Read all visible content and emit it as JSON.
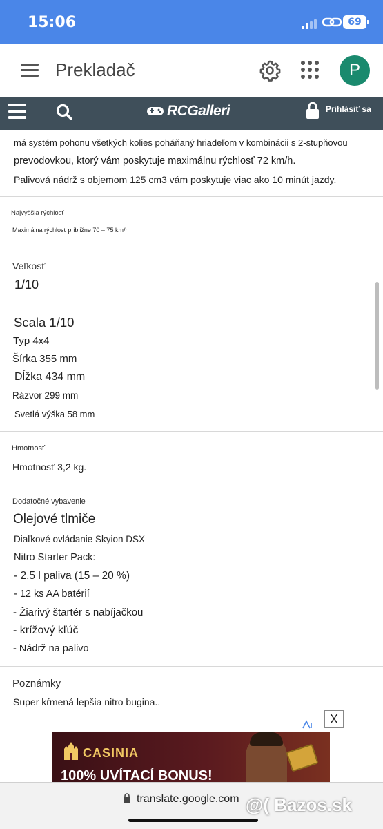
{
  "status_bar": {
    "time": "15:06",
    "battery": "69"
  },
  "app_header": {
    "title": "Prekladač",
    "avatar_letter": "P"
  },
  "site_bar": {
    "logo_text": "RCGalleri",
    "login_label": "Prihlásiť sa"
  },
  "description": {
    "line1": "má systém pohonu všetkých kolies poháňaný hriadeľom v kombinácii s 2-stupňovou",
    "line2": "prevodovkou, ktorý vám poskytuje maximálnu rýchlosť 72 km/h.",
    "line3": "Palivová nádrž s objemom 125 cm3 vám poskytuje viac ako 10 minút jazdy."
  },
  "top_speed": {
    "label": "Najvyššia rýchlosť",
    "value": "Maximálna rýchlosť približne 70 – 75 km/h"
  },
  "size": {
    "label": "Veľkosť",
    "value": "1/10",
    "scale": "Scala 1/10",
    "type": "Typ 4x4",
    "width": "Šírka 355 mm",
    "length": "Dĺžka 434 mm",
    "wheelbase": "Rázvor 299 mm",
    "clearance": "Svetlá výška 58 mm"
  },
  "weight": {
    "label": "Hmotnosť",
    "value": "Hmotnosť 3,2 kg."
  },
  "equipment": {
    "label": "Dodatočné vybavenie",
    "title": "Olejové tlmiče",
    "remote": "Diaľkové ovládanie Skyion DSX",
    "starter_pack": "Nitro Starter Pack:",
    "items": [
      "- 2,5 l paliva (15 – 20 %)",
      "- 12 ks AA batérií",
      "- Žiarivý štartér s nabíjačkou",
      "- krížový kľúč",
      "- Nádrž na palivo"
    ]
  },
  "notes": {
    "label": "Poznámky",
    "value": "Super kŕmená lepšia nitro bugina.."
  },
  "ad": {
    "brand": "CASINIA",
    "headline": "100% UVÍTACÍ BONUS!",
    "close": "X"
  },
  "browser": {
    "url": "translate.google.com"
  },
  "watermark": "@( Bazos.sk",
  "colors": {
    "status_bar": "#4a86e8",
    "site_bar": "#3f4f5a",
    "avatar": "#1a8a6e"
  }
}
